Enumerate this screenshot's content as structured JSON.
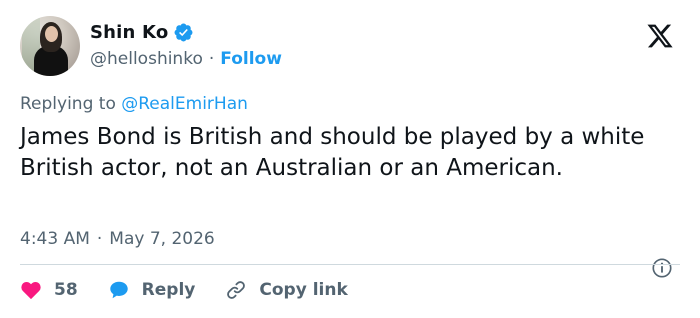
{
  "user": {
    "name": "Shin Ko",
    "handle": "@helloshinko",
    "follow_label": "Follow"
  },
  "reply_context": {
    "prefix": "Replying to",
    "mention": "@RealEmirHan"
  },
  "tweet": {
    "text": "James Bond is British and should be played by a white British actor, not an Australian or an American.",
    "time": "4:43 AM",
    "date": "May 7, 2026"
  },
  "actions": {
    "likes": "58",
    "reply_label": "Reply",
    "copy_link_label": "Copy link"
  },
  "colors": {
    "accent": "#1d9bf0",
    "like": "#f91880",
    "muted": "#536471",
    "text": "#0f1419"
  },
  "icons": [
    "verified-badge-icon",
    "x-logo-icon",
    "info-icon",
    "heart-icon",
    "reply-bubble-icon",
    "link-icon"
  ]
}
